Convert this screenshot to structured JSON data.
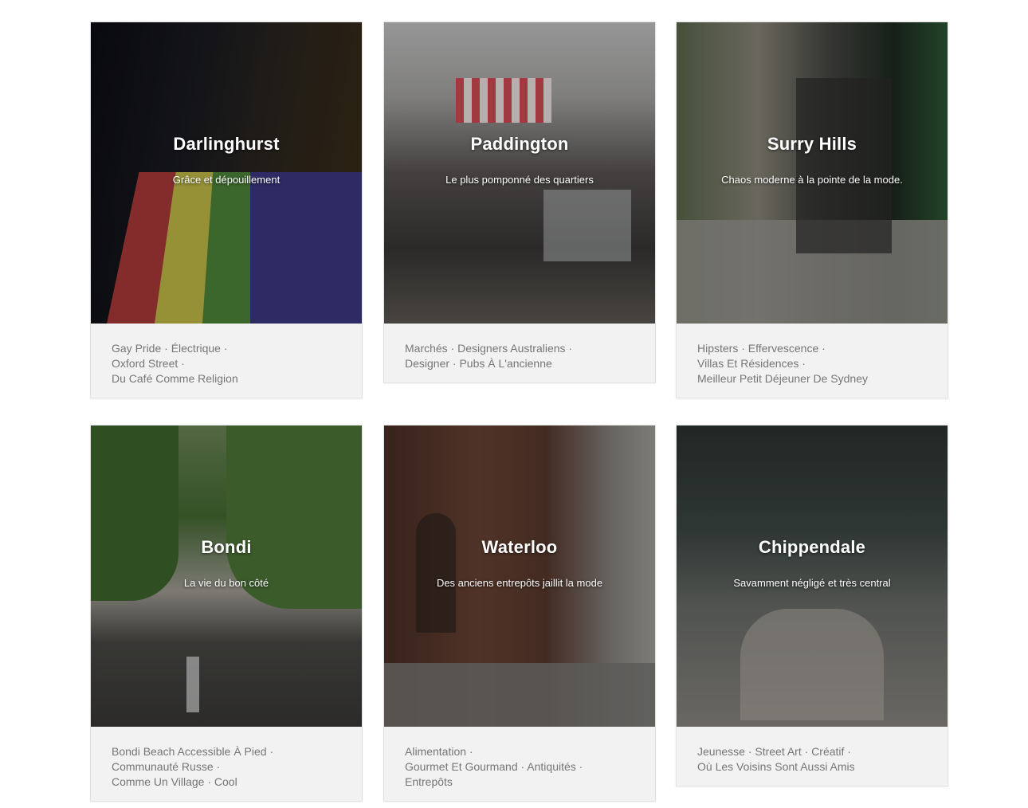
{
  "cards": [
    {
      "title": "Darlinghurst",
      "subtitle": "Grâce et dépouillement",
      "tags": [
        "Gay Pride · Électrique ·",
        "Oxford Street ·",
        "Du Café Comme Religion"
      ]
    },
    {
      "title": "Paddington",
      "subtitle": "Le plus pomponné des quartiers",
      "tags": [
        "Marchés · Designers Australiens ·",
        "Designer · Pubs À L'ancienne"
      ]
    },
    {
      "title": "Surry Hills",
      "subtitle": "Chaos moderne à la pointe de la mode.",
      "tags": [
        "Hipsters · Effervescence ·",
        "Villas Et Résidences ·",
        "Meilleur Petit Déjeuner De Sydney"
      ]
    },
    {
      "title": "Bondi",
      "subtitle": "La vie du bon côté",
      "tags": [
        "Bondi Beach Accessible À Pied ·",
        "Communauté Russe ·",
        "Comme Un Village · Cool"
      ]
    },
    {
      "title": "Waterloo",
      "subtitle": "Des anciens entrepôts jaillit la mode",
      "tags": [
        "Alimentation ·",
        "Gourmet Et Gourmand · Antiquités ·",
        "Entrepôts"
      ]
    },
    {
      "title": "Chippendale",
      "subtitle": "Savamment négligé et très central",
      "tags": [
        "Jeunesse · Street Art · Créatif ·",
        "Où Les Voisins Sont Aussi Amis"
      ]
    }
  ]
}
